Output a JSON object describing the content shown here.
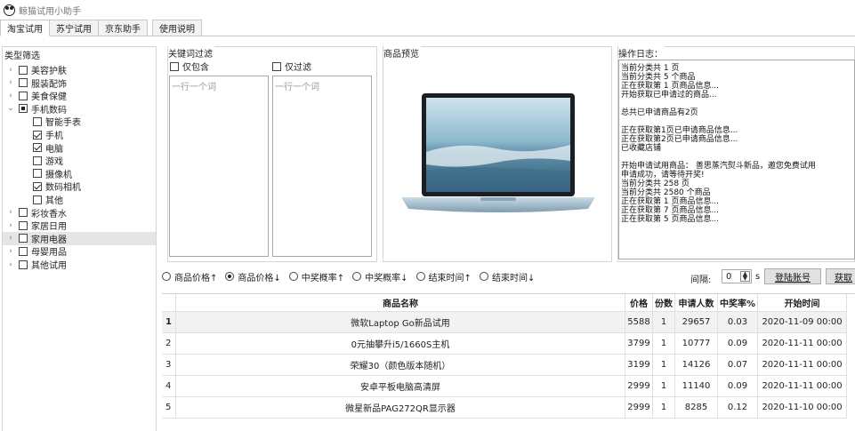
{
  "window": {
    "title": "鲸猫试用小助手"
  },
  "tabs": [
    "淘宝试用",
    "苏宁试用",
    "京东助手",
    "使用说明"
  ],
  "category_panel": {
    "title": "类型筛选",
    "items": [
      {
        "label": "美容护肤",
        "level": 0,
        "expander": "›",
        "state": "unchecked"
      },
      {
        "label": "服装配饰",
        "level": 0,
        "expander": "›",
        "state": "unchecked"
      },
      {
        "label": "美食保健",
        "level": 0,
        "expander": "›",
        "state": "unchecked"
      },
      {
        "label": "手机数码",
        "level": 0,
        "expander": "⌄",
        "state": "partial"
      },
      {
        "label": "智能手表",
        "level": 1,
        "expander": "",
        "state": "unchecked"
      },
      {
        "label": "手机",
        "level": 1,
        "expander": "",
        "state": "checked"
      },
      {
        "label": "电脑",
        "level": 1,
        "expander": "",
        "state": "checked"
      },
      {
        "label": "游戏",
        "level": 1,
        "expander": "",
        "state": "unchecked"
      },
      {
        "label": "摄像机",
        "level": 1,
        "expander": "",
        "state": "unchecked"
      },
      {
        "label": "数码相机",
        "level": 1,
        "expander": "",
        "state": "checked"
      },
      {
        "label": "其他",
        "level": 1,
        "expander": "",
        "state": "unchecked"
      },
      {
        "label": "彩妆香水",
        "level": 0,
        "expander": "›",
        "state": "unchecked"
      },
      {
        "label": "家居日用",
        "level": 0,
        "expander": "›",
        "state": "unchecked"
      },
      {
        "label": "家用电器",
        "level": 0,
        "expander": "›",
        "state": "unchecked",
        "selected": true
      },
      {
        "label": "母婴用品",
        "level": 0,
        "expander": "›",
        "state": "unchecked"
      },
      {
        "label": "其他试用",
        "level": 0,
        "expander": "›",
        "state": "unchecked"
      }
    ]
  },
  "keyword_filter": {
    "title": "关键词过滤",
    "include_label": "仅包含",
    "exclude_label": "仅过滤",
    "include_placeholder": "一行一个词",
    "exclude_placeholder": "一行一个词"
  },
  "preview": {
    "title": "商品预览"
  },
  "log": {
    "title": "操作日志：",
    "lines": [
      "当前分类共 1 页",
      "当前分类共 5 个商品",
      "正在获取第 1 页商品信息...",
      "开始获取已申请过的商品...",
      "",
      "总共已申请商品有2页",
      "",
      "正在获取第1页已申请商品信息...",
      "正在获取第2页已申请商品信息...",
      "已收藏店铺",
      "",
      "开始申请试用商品： 善思蒸汽熨斗新品，邀您免费试用",
      "申请成功，请等待开奖!",
      "当前分类共 258 页",
      "当前分类共 2580 个商品",
      "正在获取第 1 页商品信息...",
      "正在获取第 7 页商品信息...",
      "正在获取第 5 页商品信息..."
    ]
  },
  "sort_options": [
    {
      "label": "商品价格↑",
      "selected": false
    },
    {
      "label": "商品价格↓",
      "selected": true
    },
    {
      "label": "中奖概率↑",
      "selected": false
    },
    {
      "label": "中奖概率↓",
      "selected": false
    },
    {
      "label": "结束时间↑",
      "selected": false
    },
    {
      "label": "结束时间↓",
      "selected": false
    }
  ],
  "controls": {
    "interval_label": "间隔:",
    "interval_value": "0",
    "interval_unit": "s",
    "login_button": "登陆账号",
    "fetch_button": "获取"
  },
  "table": {
    "columns": [
      "",
      "商品名称",
      "价格",
      "份数",
      "申请人数",
      "中奖率%",
      "开始时间"
    ],
    "rows": [
      [
        "1",
        "微软Laptop Go新品试用",
        "5588",
        "1",
        "29657",
        "0.03",
        "2020-11-09 00:00"
      ],
      [
        "2",
        "0元抽攀升i5/1660S主机",
        "3799",
        "1",
        "10777",
        "0.09",
        "2020-11-11 00:00"
      ],
      [
        "3",
        "荣耀30（颜色版本随机）",
        "3199",
        "1",
        "14126",
        "0.07",
        "2020-11-11 00:00"
      ],
      [
        "4",
        "安卓平板电脑高清屏",
        "2999",
        "1",
        "11140",
        "0.09",
        "2020-11-11 00:00"
      ],
      [
        "5",
        "微星新品PAG272QR显示器",
        "2999",
        "1",
        "8285",
        "0.12",
        "2020-11-10 00:00"
      ]
    ]
  }
}
